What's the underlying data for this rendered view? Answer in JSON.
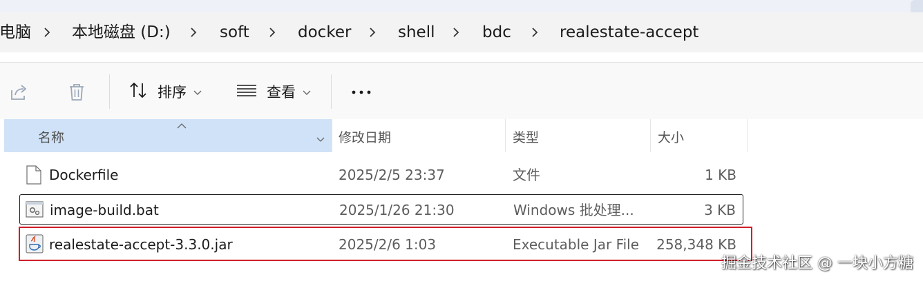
{
  "breadcrumb": {
    "items": [
      "此电脑",
      "本地磁盘 (D:)",
      "soft",
      "docker",
      "shell",
      "bdc",
      "realestate-accept"
    ]
  },
  "toolbar": {
    "share_icon": "share-icon",
    "delete_icon": "trash-icon",
    "sort_label": "排序",
    "view_label": "查看",
    "more_label": "•••"
  },
  "columns": {
    "name": "名称",
    "modified": "修改日期",
    "type": "类型",
    "size": "大小"
  },
  "files": [
    {
      "name": "Dockerfile",
      "modified": "2025/2/5 23:37",
      "type": "文件",
      "size": "1 KB",
      "icon": "file-icon"
    },
    {
      "name": "image-build.bat",
      "modified": "2025/1/26 21:30",
      "type": "Windows 批处理...",
      "size": "3 KB",
      "icon": "batch-file-icon"
    },
    {
      "name": "realestate-accept-3.3.0.jar",
      "modified": "2025/2/6 1:03",
      "type": "Executable Jar File",
      "size": "258,348 KB",
      "icon": "jar-file-icon"
    }
  ],
  "colors": {
    "header_selected_bg": "#cfe2f7",
    "highlight_box": "#cf1f2a",
    "accent": "#0067c0"
  },
  "watermark": "掘金技术社区 @ 一块小方糖"
}
